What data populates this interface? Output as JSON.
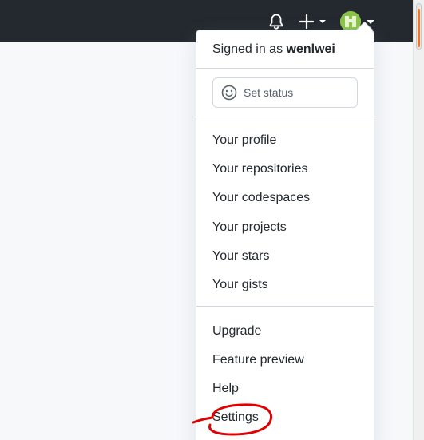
{
  "header": {
    "notifications_icon": "bell-icon",
    "create_icon": "plus-icon",
    "avatar_icon": "user-avatar"
  },
  "menu": {
    "signed_in_prefix": "Signed in as",
    "username": "wenlwei",
    "set_status_label": "Set status",
    "set_status_icon": "smiley-icon",
    "group_profile": [
      "Your profile",
      "Your repositories",
      "Your codespaces",
      "Your projects",
      "Your stars",
      "Your gists"
    ],
    "group_account": [
      "Upgrade",
      "Feature preview",
      "Help",
      "Settings"
    ]
  },
  "colors": {
    "header_bg": "#24292f",
    "annotation": "#e00000"
  }
}
